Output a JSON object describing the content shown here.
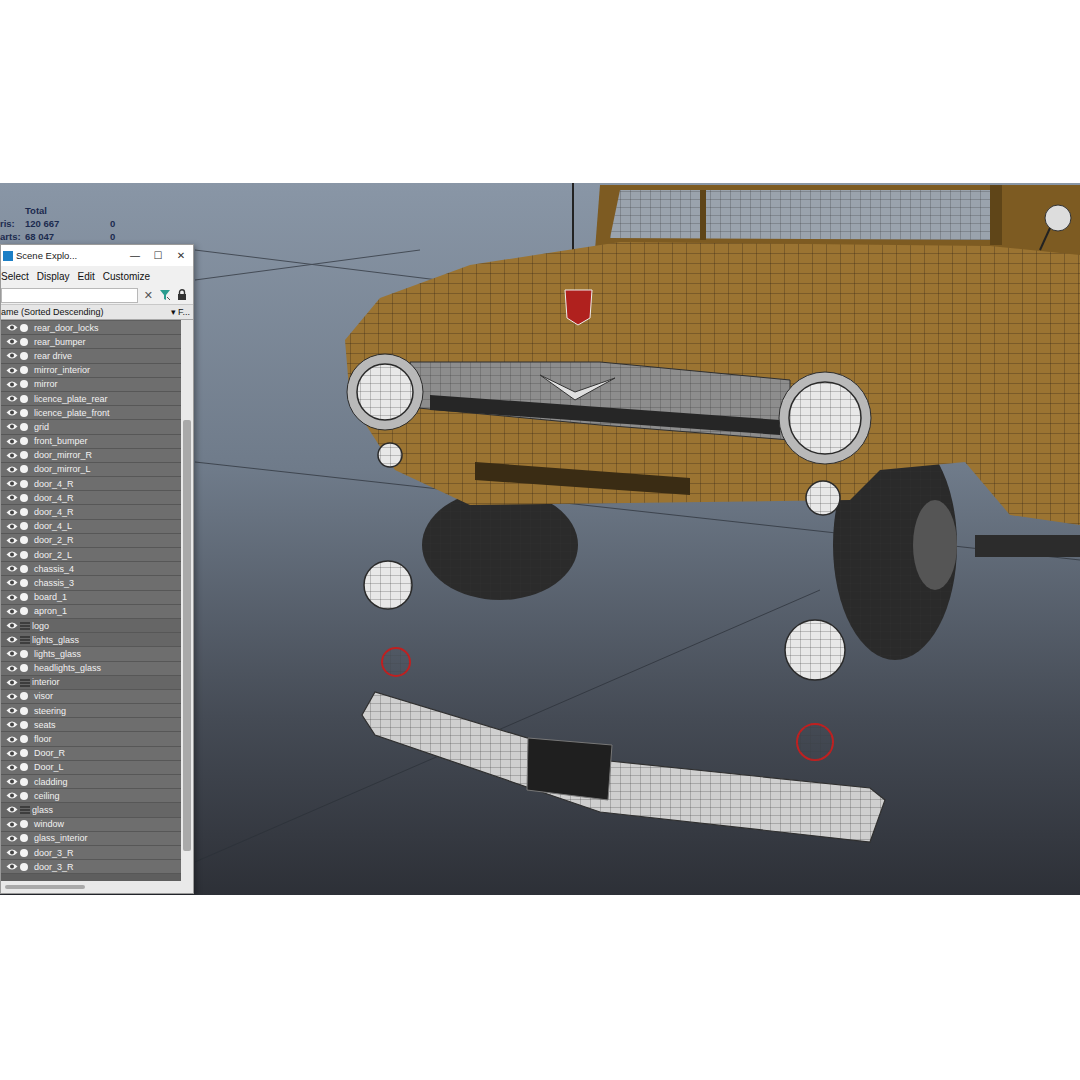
{
  "viewport": {
    "stats": {
      "header": "Total",
      "rows": [
        {
          "label": "ris:",
          "total": "120 667",
          "selected": "0"
        },
        {
          "label": "arts:",
          "total": "68 047",
          "selected": "0"
        }
      ]
    }
  },
  "explorer": {
    "title": "Scene Explo...",
    "window_buttons": [
      "—",
      "☐",
      "✕"
    ],
    "menu": [
      "Select",
      "Display",
      "Edit",
      "Customize"
    ],
    "search": {
      "placeholder": ""
    },
    "clear_button": "✕",
    "column_header": "ame (Sorted Descending)",
    "column_extra": "▾ F...",
    "items": [
      {
        "name": "rear_door_locks",
        "kind": "object",
        "visible": true
      },
      {
        "name": "rear_bumper",
        "kind": "object",
        "visible": true
      },
      {
        "name": "rear drive",
        "kind": "object",
        "visible": true
      },
      {
        "name": "mirror_interior",
        "kind": "object",
        "visible": true
      },
      {
        "name": "mirror",
        "kind": "object",
        "visible": true
      },
      {
        "name": "licence_plate_rear",
        "kind": "object",
        "visible": true
      },
      {
        "name": "licence_plate_front",
        "kind": "object",
        "visible": true
      },
      {
        "name": "grid",
        "kind": "object",
        "visible": true
      },
      {
        "name": "front_bumper",
        "kind": "object",
        "visible": true
      },
      {
        "name": "door_mirror_R",
        "kind": "object",
        "visible": true
      },
      {
        "name": "door_mirror_L",
        "kind": "object",
        "visible": true
      },
      {
        "name": "door_4_R",
        "kind": "object",
        "visible": true
      },
      {
        "name": "door_4_R",
        "kind": "object",
        "visible": true
      },
      {
        "name": "door_4_R",
        "kind": "object",
        "visible": true
      },
      {
        "name": "door_4_L",
        "kind": "object",
        "visible": true
      },
      {
        "name": "door_2_R",
        "kind": "object",
        "visible": true
      },
      {
        "name": "door_2_L",
        "kind": "object",
        "visible": true
      },
      {
        "name": "chassis_4",
        "kind": "object",
        "visible": true
      },
      {
        "name": "chassis_3",
        "kind": "object",
        "visible": true
      },
      {
        "name": "board_1",
        "kind": "object",
        "visible": true
      },
      {
        "name": "apron_1",
        "kind": "object",
        "visible": true
      },
      {
        "name": "logo",
        "kind": "layer",
        "visible": true
      },
      {
        "name": "lights_glass",
        "kind": "layer",
        "visible": true
      },
      {
        "name": "lights_glass",
        "kind": "object",
        "visible": true
      },
      {
        "name": "headlights_glass",
        "kind": "object",
        "visible": true
      },
      {
        "name": "interior",
        "kind": "layer",
        "visible": true
      },
      {
        "name": "visor",
        "kind": "object",
        "visible": true
      },
      {
        "name": "steering",
        "kind": "object",
        "visible": true
      },
      {
        "name": "seats",
        "kind": "object",
        "visible": true
      },
      {
        "name": "floor",
        "kind": "object",
        "visible": true
      },
      {
        "name": "Door_R",
        "kind": "object",
        "visible": true
      },
      {
        "name": "Door_L",
        "kind": "object",
        "visible": true
      },
      {
        "name": "cladding",
        "kind": "object",
        "visible": true
      },
      {
        "name": "ceiling",
        "kind": "object",
        "visible": true
      },
      {
        "name": "glass",
        "kind": "layer",
        "visible": true
      },
      {
        "name": "window",
        "kind": "object",
        "visible": true
      },
      {
        "name": "glass_interior",
        "kind": "object",
        "visible": true
      },
      {
        "name": "door_3_R",
        "kind": "object",
        "visible": true
      },
      {
        "name": "door_3_R",
        "kind": "object",
        "visible": true
      }
    ]
  }
}
